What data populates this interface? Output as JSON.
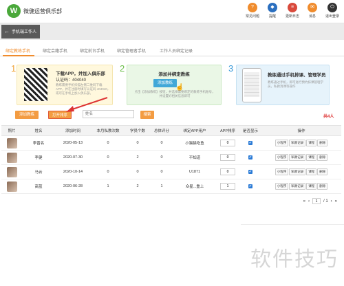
{
  "header": {
    "logo_letter": "W",
    "brand": "微健运营俱乐部",
    "nav": [
      {
        "label": "常见问题",
        "icon": "question-icon",
        "color": "#f08c2d",
        "glyph": "?"
      },
      {
        "label": "提醒",
        "icon": "bell-icon",
        "color": "#2b6fbf",
        "glyph": "◆"
      },
      {
        "label": "更新日志",
        "icon": "log-icon",
        "color": "#d94a3c",
        "glyph": "≡"
      },
      {
        "label": "消息",
        "icon": "message-icon",
        "color": "#f08c2d",
        "glyph": "✉"
      },
      {
        "label": "退出登录",
        "icon": "logout-icon",
        "color": "#333333",
        "glyph": "⏻"
      }
    ]
  },
  "subbar": {
    "back_label": "手机端工作人员"
  },
  "tabs": [
    "绑定教练手机",
    "绑定会籍手机",
    "绑定前台手机",
    "绑定管理者手机",
    "工作人员绑定记录"
  ],
  "steps": {
    "s1": {
      "num": "1",
      "title": "下载APP，并加入俱乐部",
      "code": "认证码：404040",
      "desc": "教练需要手机扫描左侧二维码下载APP，并在注册时填写认证码 404040，或可在手机上加入俱乐部。"
    },
    "s2": {
      "num": "2",
      "title": "添加并绑定教练",
      "button": "添加教练",
      "desc": "点击【添加教练】按钮，并选择需要绑定的教练手机账号，并设置好相关信息即可"
    },
    "s3": {
      "num": "3",
      "title": "教练通过手机排课、管理学员",
      "desc": "教练通过手机，即可进行预约排课管理学员，私教消课等操作"
    }
  },
  "toolbar": {
    "add_button": "添加教练",
    "sort_button": "打开排序",
    "search_placeholder": "姓名",
    "search_button": "搜索",
    "total": "共4人"
  },
  "table": {
    "columns": [
      "照片",
      "姓名",
      "添加时间",
      "本月私教次数",
      "学员个数",
      "总体评分",
      "绑定APP用户",
      "APP排序",
      "是否显示",
      "操作"
    ],
    "rows": [
      {
        "name": "李晋名",
        "date": "2020-05-13",
        "sessions": "0",
        "students": "0",
        "score": "0",
        "app_user": "小猫猫吃鱼",
        "sort": "0",
        "show": "✔"
      },
      {
        "name": "李健",
        "date": "2020-07-30",
        "sessions": "0",
        "students": "2",
        "score": "0",
        "app_user": "不知道",
        "sort": "0",
        "show": "✔"
      },
      {
        "name": "马云",
        "date": "2020-10-14",
        "sessions": "0",
        "students": "0",
        "score": "0",
        "app_user": "U1871",
        "sort": "0",
        "show": "✔"
      },
      {
        "name": "高蓝",
        "date": "2020-06-28",
        "sessions": "1",
        "students": "2",
        "score": "1",
        "app_user": "众星...重上",
        "sort": "1",
        "show": "✔"
      }
    ],
    "actions": [
      "小程序",
      "私教记录",
      "课程",
      "删除"
    ]
  },
  "pager": {
    "first": "«",
    "prev": "‹",
    "page": "1",
    "total": "/ 1",
    "next": "›",
    "last": "»"
  },
  "watermark": "软件技巧"
}
